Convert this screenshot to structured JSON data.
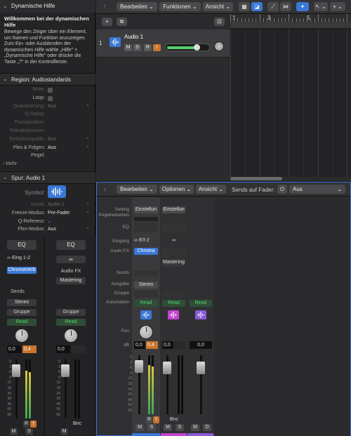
{
  "colors": {
    "accent": "#3a78d6",
    "read": "#3aa655",
    "record": "#c8742e",
    "purple": "#8a5bd6",
    "magenta": "#c444d0"
  },
  "help": {
    "title": "Dynamische Hilfe",
    "heading": "Willkommen bei der dynamischen Hilfe",
    "body": "Bewege den Zeiger über ein Element, um Namen und Funktion anzuzeigen. Zum Ein- oder Ausblenden der dynamischen Hilfe wähle „Hilfe\" > „Dynamische Hilfe\" oder drücke die Taste „?\" in der Kontrollleiste."
  },
  "region": {
    "header": "Region: Audiostandards",
    "rows": [
      {
        "label": "Mute:",
        "value": "",
        "enabled": false
      },
      {
        "label": "Loop:",
        "value": "",
        "enabled": true
      },
      {
        "label": "Quantisierung:",
        "value": "Aus",
        "enabled": false
      },
      {
        "label": "Q-Swing:",
        "value": "",
        "enabled": false
      },
      {
        "label": "Transposition:",
        "value": "",
        "enabled": false
      },
      {
        "label": "Feinabstimmen:",
        "value": "",
        "enabled": false
      },
      {
        "label": "Tonhöhenquelle:",
        "value": "Aus",
        "enabled": false
      },
      {
        "label": "Flex & Folgen:",
        "value": "Aus",
        "enabled": true
      },
      {
        "label": "Pegel:",
        "value": "",
        "enabled": true
      }
    ],
    "more": "Mehr"
  },
  "track_inspector": {
    "header": "Spur:  Audio 1",
    "symbol": "Symbol:",
    "rows": [
      {
        "label": "Kanal:",
        "value": "Audio 1",
        "enabled": false
      },
      {
        "label": "Freeze-Modus:",
        "value": "Pre-Fader",
        "enabled": true
      },
      {
        "label": "Q-Referenz:",
        "value": "✓",
        "enabled": true
      },
      {
        "label": "Flex-Modus:",
        "value": "Aus",
        "enabled": true
      }
    ]
  },
  "inspector_strips": {
    "left": {
      "eq": "EQ",
      "input": "Eing 1-2",
      "plugin": "ChromaVerb",
      "sends": "Sends",
      "output": "Stereo",
      "group": "Gruppe",
      "auto": "Read",
      "vol_l": "0,0",
      "vol_r": "0,4",
      "mute": "M",
      "solo": "S",
      "rec": "R",
      "in": "I"
    },
    "right": {
      "eq": "EQ",
      "fx": "Audio FX",
      "mastering": "Mastering",
      "group": "Gruppe",
      "auto": "Read",
      "vol": "0,0",
      "bnc": "Bnc",
      "mute": "M"
    }
  },
  "tracks_menu": {
    "edit": "Bearbeiten",
    "functions": "Funktionen",
    "view": "Ansicht"
  },
  "ruler": [
    "1",
    "3",
    "5"
  ],
  "track": {
    "number": "1",
    "name": "Audio 1",
    "m": "M",
    "s": "S",
    "r": "R",
    "i": "I"
  },
  "mixer_menu": {
    "edit": "Bearbeiten",
    "options": "Optionen",
    "view": "Ansicht",
    "sends_label": "Sends auf Fader:",
    "sends_value": "Aus"
  },
  "mixer_labels": [
    "Setting",
    "Pegelreduktion",
    "EQ",
    "Eingang",
    "Audio FX",
    "Sends",
    "Ausgabe",
    "Gruppe",
    "Automation",
    "Pan",
    "dB"
  ],
  "mixer": {
    "s1": {
      "setting": "Einstellun",
      "input": "E/I-2",
      "fx": "Chroma",
      "output": "Stereo",
      "auto": "Read",
      "vl": "0,0",
      "vr": "0,4",
      "m": "M",
      "s": "S",
      "r": "R",
      "i": "I"
    },
    "s2": {
      "setting": "Einstellun",
      "fx": "Mastering",
      "auto": "Read",
      "vol": "0,0",
      "bnc": "Bnc",
      "m": "M",
      "s": "S"
    },
    "s3": {
      "auto": "Read",
      "vol": "0,0",
      "m": "M",
      "d": "D"
    }
  },
  "fader_scale": [
    "0",
    "3",
    "6",
    "9",
    "12",
    "18",
    "24",
    "30",
    "40",
    "50",
    "60"
  ]
}
